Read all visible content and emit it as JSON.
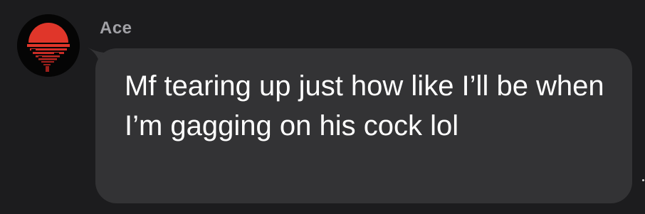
{
  "message": {
    "sender": "Ace",
    "text": "Mf tearing up just how like I’ll be when I’m gagging on his cock lol",
    "avatar_icon": "red-sunset-reflection-icon"
  },
  "colors": {
    "background": "#1c1c1e",
    "bubble": "#333335",
    "sender": "#a1a1a6",
    "text": "#ffffff",
    "avatar_red": "#e0362a"
  }
}
